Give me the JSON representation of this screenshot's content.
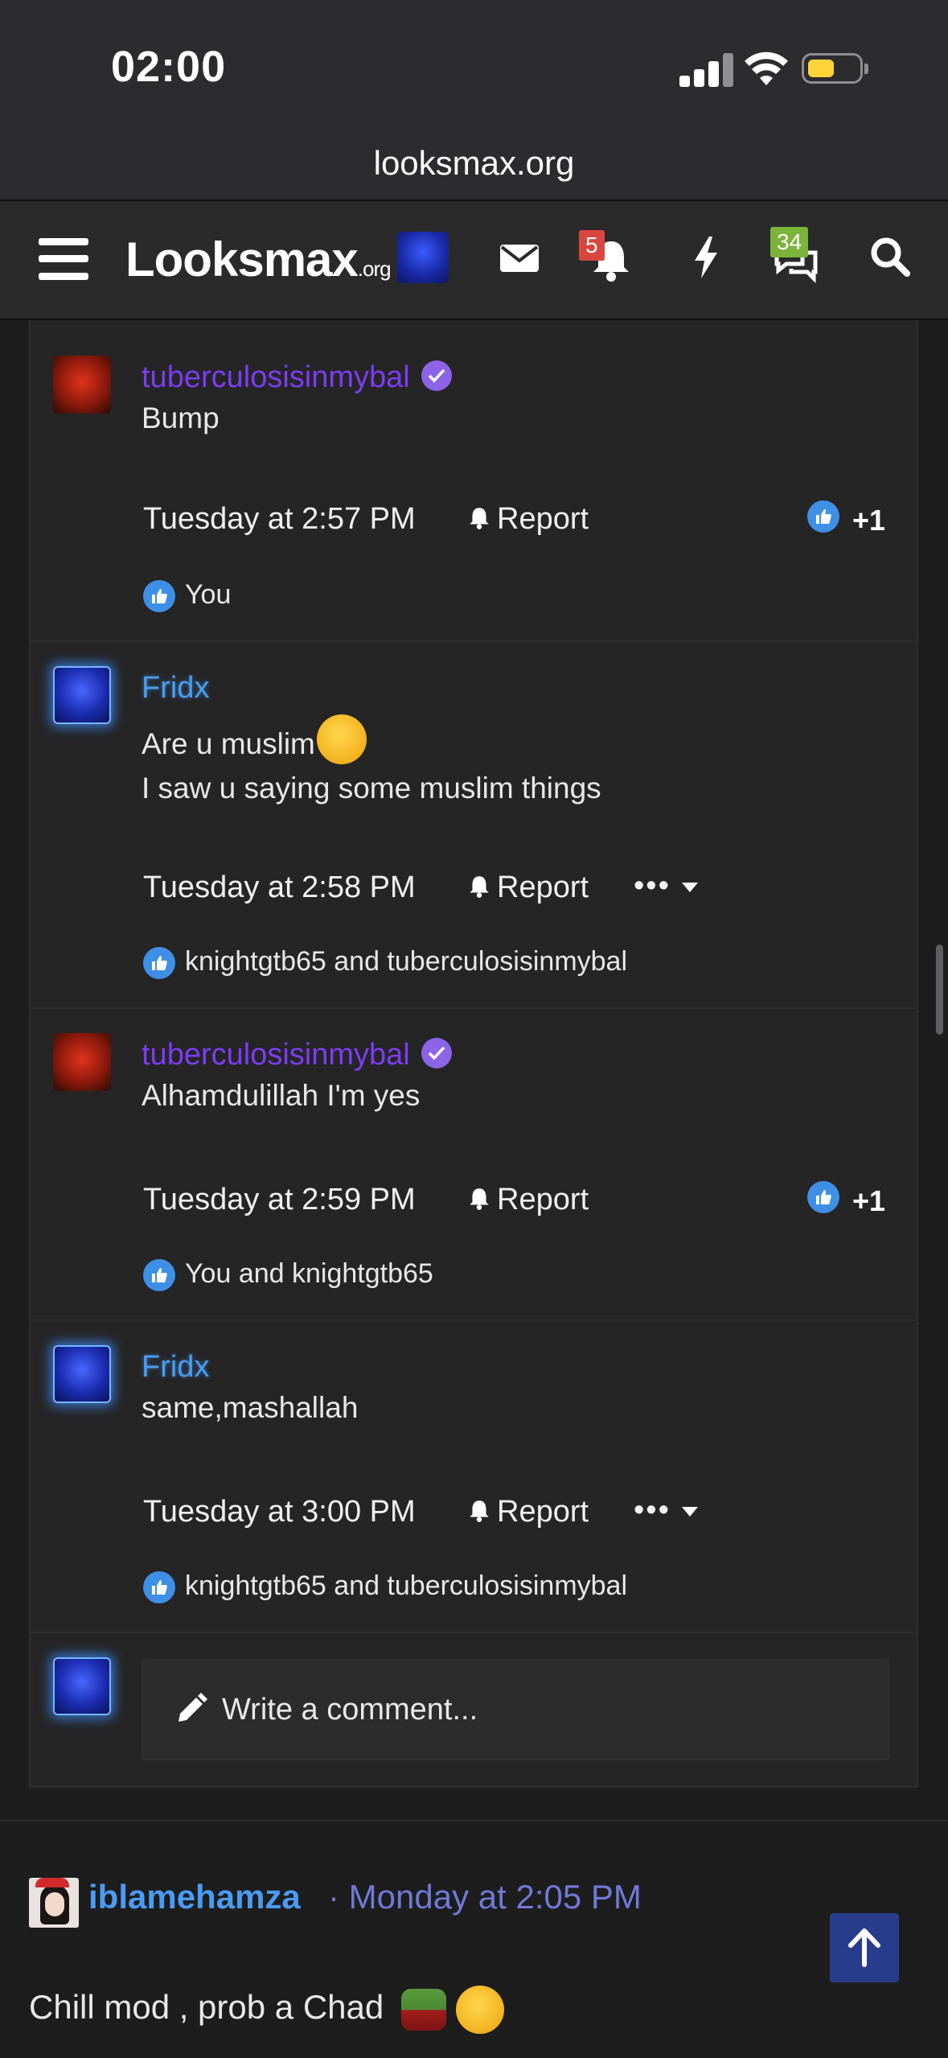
{
  "status_bar": {
    "time": "02:00"
  },
  "browser": {
    "url": "looksmax.org"
  },
  "header": {
    "logo_text": "Looksmax",
    "logo_suffix": ".org",
    "alerts_badge": "5",
    "conversations_badge": "34",
    "badge_colors": {
      "alerts": "#d9463d",
      "conversations": "#7bb33b"
    }
  },
  "comments": [
    {
      "author": "tuberculosisinmybal",
      "verified": true,
      "lines": [
        "Bump"
      ],
      "date": "Tuesday at 2:57 PM",
      "report_label": "Report",
      "reaction_count": "+1",
      "liked_by": "You"
    },
    {
      "author": "Fridx",
      "verified": false,
      "lines": [
        "Are u muslim",
        "I saw u saying some muslim things"
      ],
      "date": "Tuesday at 2:58 PM",
      "report_label": "Report",
      "more_label": "•••",
      "liked_by": "knightgtb65 and tuberculosisinmybal"
    },
    {
      "author": "tuberculosisinmybal",
      "verified": true,
      "lines": [
        "Alhamdulillah I'm yes"
      ],
      "date": "Tuesday at 2:59 PM",
      "report_label": "Report",
      "reaction_count": "+1",
      "liked_by": "You and knightgtb65"
    },
    {
      "author": "Fridx",
      "verified": false,
      "lines": [
        "same,mashallah"
      ],
      "date": "Tuesday at 3:00 PM",
      "report_label": "Report",
      "more_label": "•••",
      "liked_by": "knightgtb65 and tuberculosisinmybal"
    }
  ],
  "write_comment": {
    "placeholder": "Write a comment..."
  },
  "post": {
    "author": "iblamehamza",
    "separator": "·",
    "date": "Monday at 2:05 PM",
    "text": "Chill mod , prob a Chad"
  }
}
